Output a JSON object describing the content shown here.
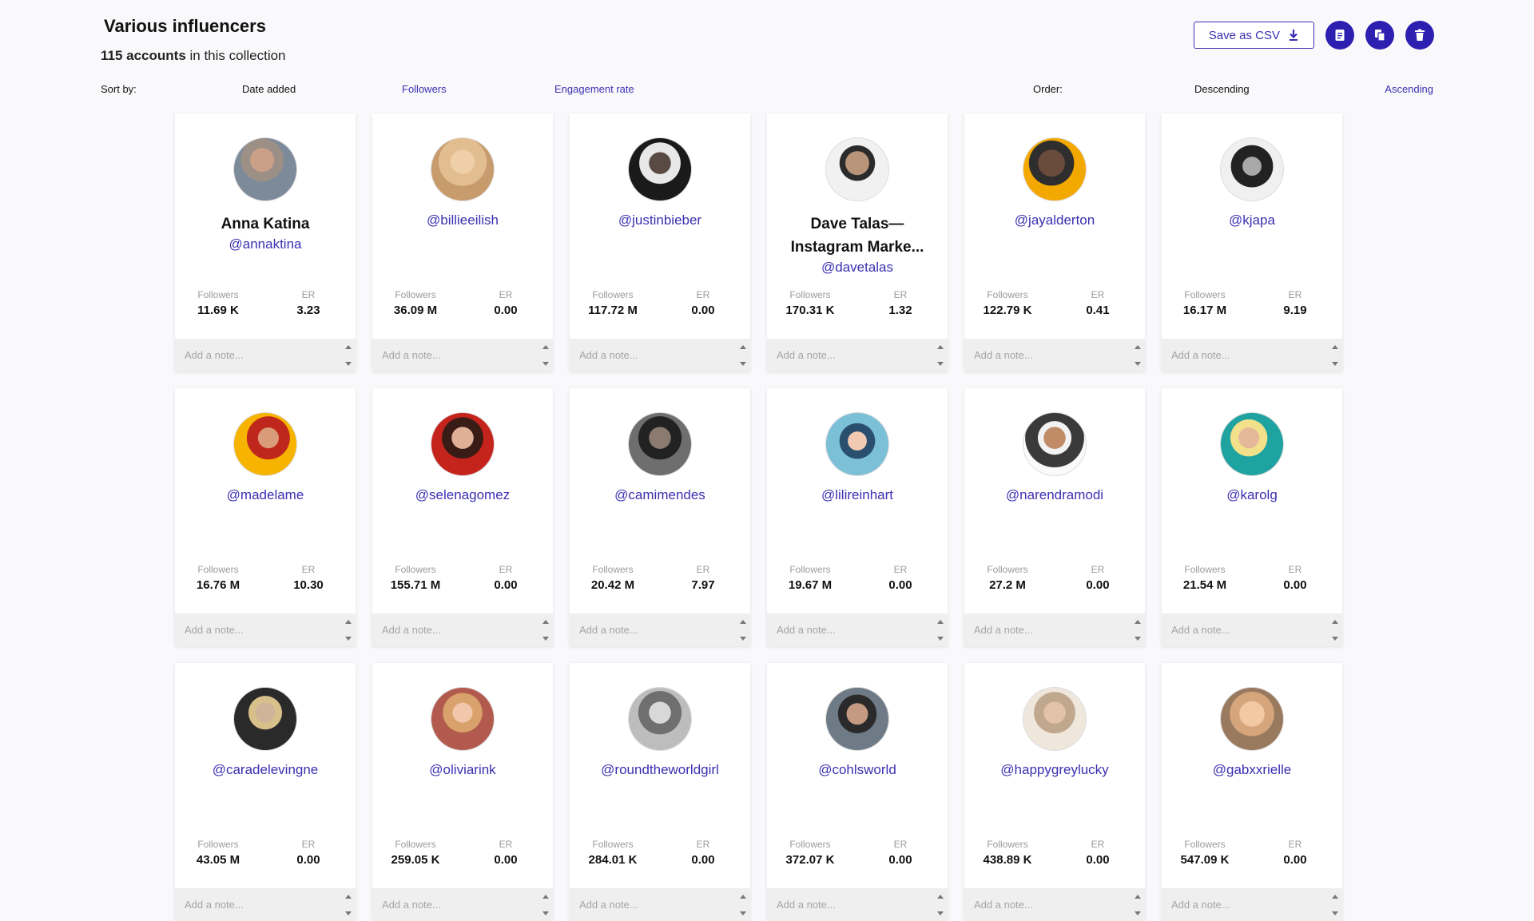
{
  "header": {
    "title": "Various influencers",
    "count_strong": "115 accounts",
    "count_rest": " in this collection"
  },
  "toolbar": {
    "csv_label": "Save as CSV",
    "icons": [
      "download-icon",
      "note-icon",
      "copy-icon",
      "trash-icon"
    ]
  },
  "sort": {
    "label": "Sort by:",
    "options": [
      "Date added",
      "Followers",
      "Engagement rate"
    ],
    "order_label": "Order:",
    "order_options": [
      "Descending",
      "Ascending"
    ]
  },
  "card_labels": {
    "followers": "Followers",
    "er": "ER",
    "note_placeholder": "Add a note..."
  },
  "colors": {
    "accent": "#3c2fb1",
    "button": "#2d1fb0",
    "background": "#f9f9fb"
  },
  "influencers": [
    {
      "name": "Anna Katina",
      "handle": "@annaktina",
      "followers": "11.69 K",
      "er": "3.23"
    },
    {
      "name": "",
      "handle": "@billieeilish",
      "followers": "36.09 M",
      "er": "0.00"
    },
    {
      "name": "",
      "handle": "@justinbieber",
      "followers": "117.72 M",
      "er": "0.00"
    },
    {
      "name": "Dave Talas— Instagram Marke...",
      "handle": "@davetalas",
      "followers": "170.31 K",
      "er": "1.32"
    },
    {
      "name": "",
      "handle": "@jayalderton",
      "followers": "122.79 K",
      "er": "0.41"
    },
    {
      "name": "",
      "handle": "@kjapa",
      "followers": "16.17 M",
      "er": "9.19"
    },
    {
      "name": "",
      "handle": "@madelame",
      "followers": "16.76 M",
      "er": "10.30"
    },
    {
      "name": "",
      "handle": "@selenagomez",
      "followers": "155.71 M",
      "er": "0.00"
    },
    {
      "name": "",
      "handle": "@camimendes",
      "followers": "20.42 M",
      "er": "7.97"
    },
    {
      "name": "",
      "handle": "@lilireinhart",
      "followers": "19.67 M",
      "er": "0.00"
    },
    {
      "name": "",
      "handle": "@narendramodi",
      "followers": "27.2 M",
      "er": "0.00"
    },
    {
      "name": "",
      "handle": "@karolg",
      "followers": "21.54 M",
      "er": "0.00"
    },
    {
      "name": "",
      "handle": "@caradelevingne",
      "followers": "43.05 M",
      "er": "0.00"
    },
    {
      "name": "",
      "handle": "@oliviarink",
      "followers": "259.05 K",
      "er": "0.00"
    },
    {
      "name": "",
      "handle": "@roundtheworldgirl",
      "followers": "284.01 K",
      "er": "0.00"
    },
    {
      "name": "",
      "handle": "@cohlsworld",
      "followers": "372.07 K",
      "er": "0.00"
    },
    {
      "name": "",
      "handle": "@happygreylucky",
      "followers": "438.89 K",
      "er": "0.00"
    },
    {
      "name": "",
      "handle": "@gabxxrielle",
      "followers": "547.09 K",
      "er": "0.00"
    }
  ]
}
